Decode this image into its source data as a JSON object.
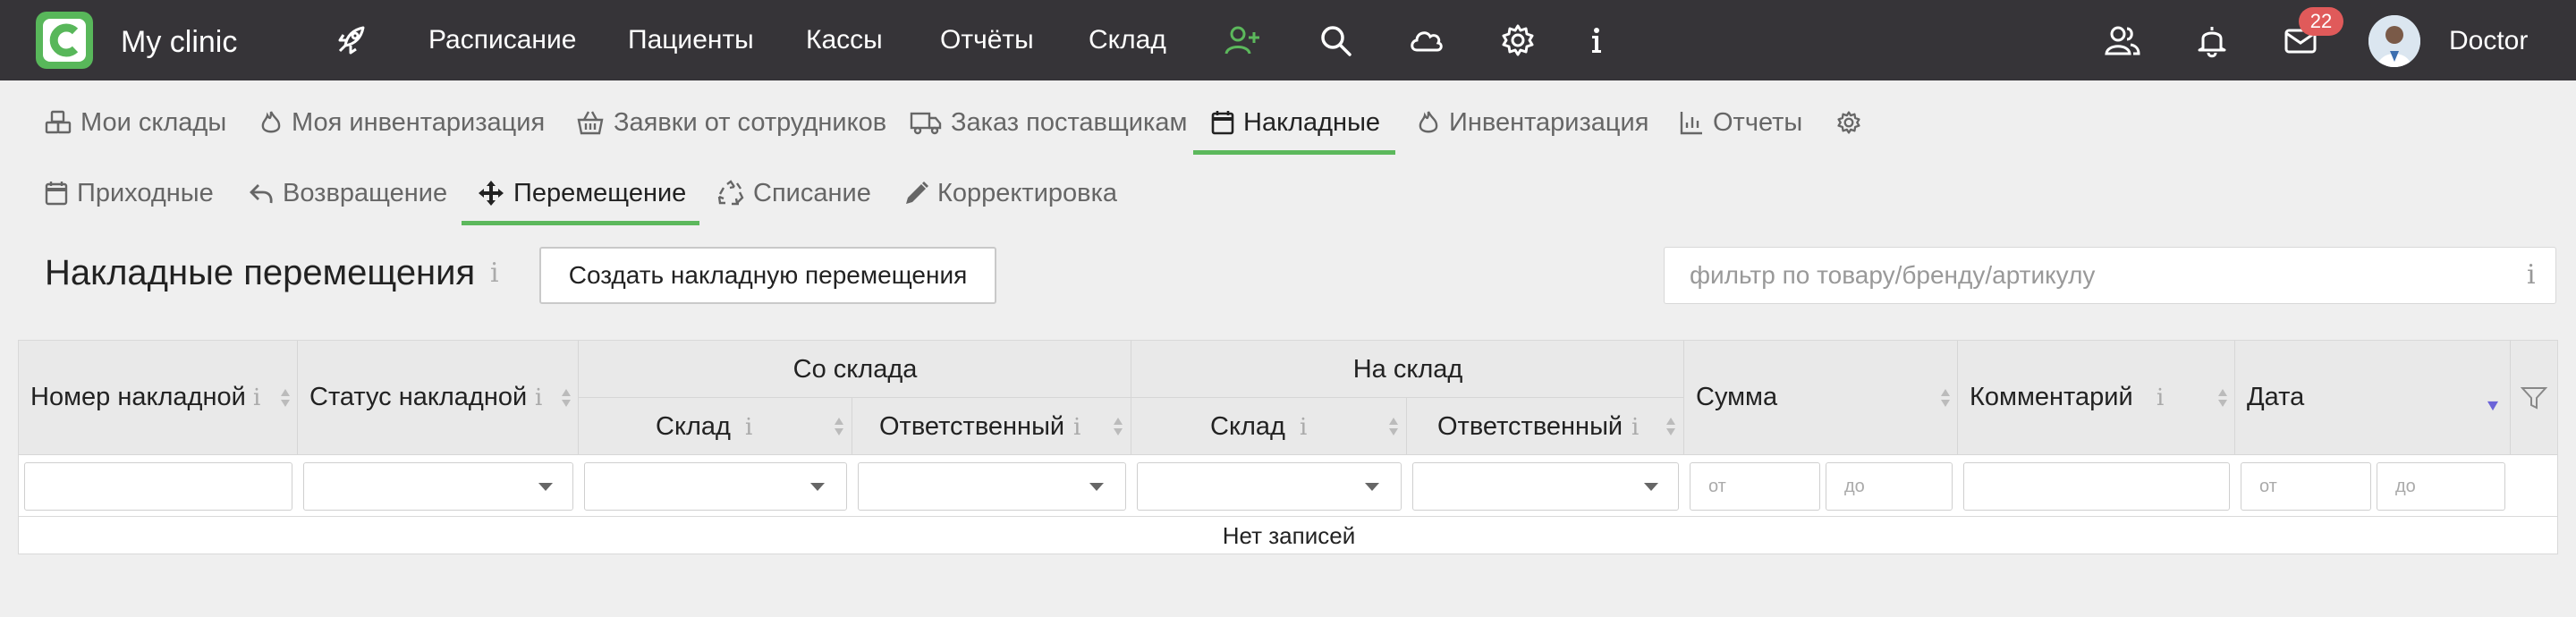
{
  "app": {
    "title": "My clinic"
  },
  "nav": {
    "items": [
      "Расписание",
      "Пациенты",
      "Кассы",
      "Отчёты",
      "Склад"
    ],
    "notifications_count": "22",
    "user_name": "Doctor"
  },
  "tabs": {
    "primary": [
      "Мои склады",
      "Моя инвентаризация",
      "Заявки от сотрудников",
      "Заказ поставщикам",
      "Накладные",
      "Инвентаризация",
      "Отчеты"
    ],
    "secondary": [
      "Приходные",
      "Возвращение",
      "Перемещение",
      "Списание",
      "Корректировка"
    ]
  },
  "page": {
    "title": "Накладные перемещения",
    "info_glyph": "i",
    "create_button": "Создать накладную перемещения",
    "filter_placeholder": "фильтр по товару/бренду/артикулу"
  },
  "table": {
    "group_from": "Со склада",
    "group_to": "На склад",
    "col_number": "Номер накладной",
    "col_status": "Статус накладной",
    "col_from_warehouse": "Склад",
    "col_from_responsible": "Ответственный",
    "col_to_warehouse": "Склад",
    "col_to_responsible": "Ответственный",
    "col_sum": "Сумма",
    "col_comment": "Комментарий",
    "col_date": "Дата",
    "sum_from_placeholder": "от",
    "sum_to_placeholder": "до",
    "date_from_placeholder": "от",
    "date_to_placeholder": "до",
    "empty_text": "Нет записей"
  },
  "colors": {
    "accent": "#5cb85c",
    "topbar": "#363438",
    "badge": "#e05a5a"
  }
}
